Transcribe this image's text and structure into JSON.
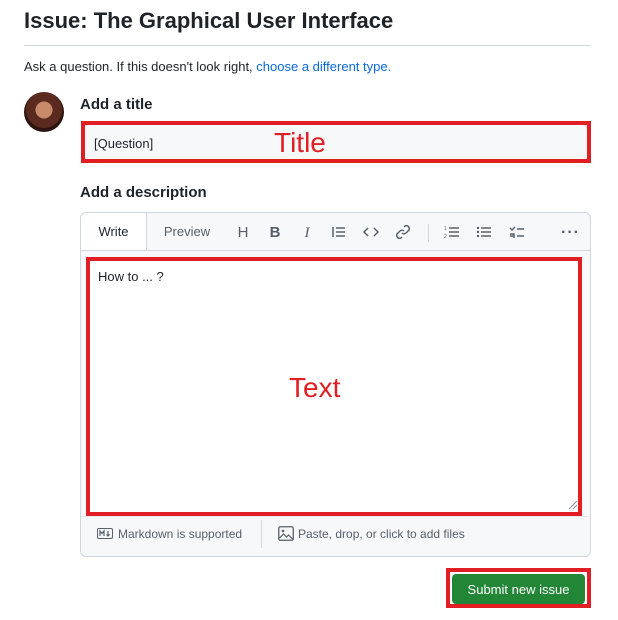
{
  "page": {
    "title": "Issue: The Graphical User Interface",
    "intro_prefix": "Ask a question. If this doesn't look right,",
    "intro_link": "choose a different type."
  },
  "title_section": {
    "label": "Add a title",
    "value": "[Question]",
    "annotation": "Title"
  },
  "description_section": {
    "label": "Add a description",
    "tabs": [
      "Write",
      "Preview"
    ],
    "active_tab": "Write",
    "toolbar_icons": [
      "heading-icon",
      "bold-icon",
      "italic-icon",
      "quote-icon",
      "code-icon",
      "link-icon",
      "ordered-list-icon",
      "unordered-list-icon",
      "task-list-icon",
      "more-icon"
    ],
    "value": "How to ... ?",
    "annotation": "Text"
  },
  "footer": {
    "markdown_label": "Markdown is supported",
    "files_label": "Paste, drop, or click to add files"
  },
  "submit": {
    "label": "Submit new issue"
  },
  "colors": {
    "annotation": "#e01e24",
    "link": "#0969da",
    "submit": "#238636"
  }
}
